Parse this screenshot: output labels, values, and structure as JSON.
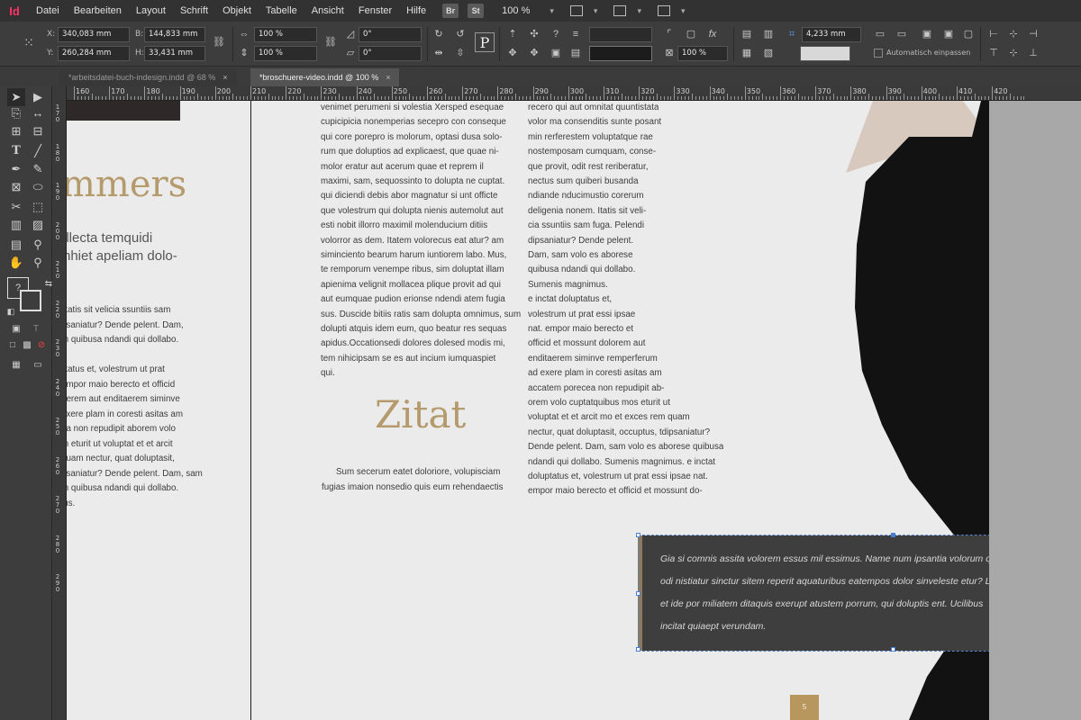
{
  "app": {
    "logo": "Id"
  },
  "menu": {
    "items": [
      "Datei",
      "Bearbeiten",
      "Layout",
      "Schrift",
      "Objekt",
      "Tabelle",
      "Ansicht",
      "Fenster",
      "Hilfe"
    ],
    "badges": [
      "Br",
      "St"
    ],
    "zoom": "100 %"
  },
  "control": {
    "x_label": "X:",
    "x_value": "340,083 mm",
    "y_label": "Y:",
    "y_value": "260,284 mm",
    "w_label": "B:",
    "w_value": "144,833 mm",
    "h_label": "H:",
    "h_value": "33,431 mm",
    "scale_x": "100 %",
    "scale_y": "100 %",
    "rotation": "0°",
    "shear": "0°",
    "stroke_weight": "4,233 mm",
    "opacity": "100 %",
    "autofit_label": "Automatisch einpassen"
  },
  "tabs": [
    {
      "label": "*arbeitsdatei-buch-indesign.indd @ 68 %",
      "close": "×"
    },
    {
      "label": "*broschuere-video.indd @ 100 %",
      "close": "×"
    }
  ],
  "ruler": {
    "h_labels": [
      "160",
      "170",
      "180",
      "190",
      "200",
      "210",
      "220",
      "230",
      "240",
      "250",
      "260",
      "270",
      "280",
      "290",
      "300",
      "310",
      "320",
      "330",
      "340",
      "350",
      "360",
      "370",
      "380",
      "390",
      "400",
      "410",
      "420"
    ],
    "v_labels": [
      "170",
      "180",
      "190",
      "200",
      "210",
      "220",
      "230",
      "240",
      "250",
      "260",
      "270",
      "280",
      "290"
    ]
  },
  "left_page": {
    "heading": "mmers",
    "subhead_lines": [
      "illecta temquidi",
      "nhiet apeliam dolo-"
    ],
    "body_lines": [
      "litatis sit velicia ssuntiis sam",
      "psaniatur? Dende pelent. Dam,",
      "m quibusa ndandi qui dollabo.",
      "",
      "litatus et, volestrum ut prat",
      "empor maio berecto et officid",
      "aerem aut enditaerem siminve",
      "exere plam in coresti asitas am",
      "ea non repudipit aborem volo",
      "m eturit ut voluptat et et arcit",
      "quam nectur, quat doluptasit,",
      "psaniatur? Dende pelent. Dam, sam",
      "m quibusa ndandi qui dollabo.",
      "ius."
    ]
  },
  "middle_column": {
    "lines": [
      "venimet perumeni si volestia Xersped esequae",
      "cupicipicia nonemperias secepro con conseque",
      "qui core porepro is molorum, optasi dusa solo-",
      "rum que doluptios ad explicaest, que quae ni-",
      "molor eratur aut acerum quae et reprem il",
      "maximi, sam, sequossinto to dolupta ne cuptat.",
      "qui diciendi debis abor magnatur si unt officte",
      "que volestrum qui dolupta nienis autemolut aut",
      "esti nobit illorro maximil molenducium ditiis",
      "volorror as dem. Itatem volorecus eat atur? am",
      "siminciento bearum harum iuntiorem labo. Mus,",
      "te remporum venempe ribus, sim doluptat illam",
      "apienima velignit mollacea plique provit ad qui",
      "aut eumquae pudion erionse ndendi atem fugia",
      "sus. Duscide bitiis ratis sam dolupta omnimus, sum",
      "dolupti atquis idem eum, quo beatur res sequas",
      "apidus.Occationsedi dolores dolesed modis mi,",
      "tem nihicipsam se es aut incium iumquaspiet",
      "qui."
    ],
    "heading": "Zitat",
    "quote_lines": [
      "Sum secerum eatet doloriore, volupisciam",
      "fugias imaion nonsedio quis eum rehendaectis"
    ]
  },
  "right_column": {
    "lines": [
      "recero qui aut omnitat quuntistata",
      "volor ma consenditis sunte posant",
      "min rerferestem voluptatque rae",
      "nostemposam cumquam, conse-",
      "que provit, odit rest reriberatur,",
      "nectus sum quiberi busanda",
      "ndiande nducimustio corerum",
      "deligenia nonem. Itatis sit veli-",
      "cia ssuntiis sam fuga. Pelendi",
      "dipsaniatur? Dende pelent.",
      "Dam, sam volo es aborese",
      "quibusa ndandi qui dollabo.",
      "Sumenis magnimus.",
      "   e inctat doluptatus et,",
      "volestrum ut prat essi ipsae",
      "nat. empor maio berecto et",
      "officid et mossunt dolorem aut",
      "enditaerem siminve remperferum",
      "ad exere plam in coresti asitas am",
      "accatem porecea non repudipit ab-",
      "orem volo cuptatquibus mos eturit ut",
      "voluptat et et arcit mo et exces rem quam",
      "nectur, quat doluptasit, occuptus, tdipsaniatur?",
      "Dende pelent. Dam, sam volo es aborese quibusa",
      "ndandi qui dollabo. Sumenis magnimus. e inctat",
      "doluptatus et, volestrum ut prat essi ipsae nat.",
      "empor maio berecto et officid et mossunt do-"
    ]
  },
  "quote_box": {
    "lines": [
      "Gia si comnis assita volorem essus mil essimus. Name num ipsantia volorum qui",
      "odi nistiatur sinctur sitem reperit aquaturibus eatempos dolor sinveleste etur? Les",
      "et ide por miliatem ditaquis exerupt atustem porrum, qui doluptis ent. Ucilibus",
      "incitat quiaept verundam."
    ]
  },
  "page_number": "5"
}
